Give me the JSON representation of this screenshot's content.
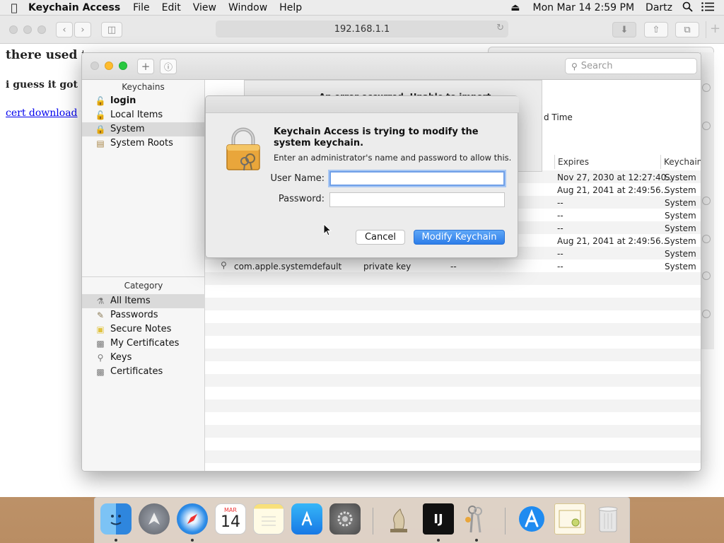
{
  "menubar": {
    "app_name": "Keychain Access",
    "menus": [
      "File",
      "Edit",
      "View",
      "Window",
      "Help"
    ],
    "clock": "Mon Mar 14  2:59 PM",
    "user": "Dartz"
  },
  "safari": {
    "url": "192.168.1.1",
    "page": {
      "heading1": "there used to",
      "heading2": "i guess it got los",
      "link": "cert download"
    }
  },
  "keychain": {
    "search_placeholder": "Search",
    "keychains_header": "Keychains",
    "keychains": [
      {
        "label": "login",
        "icon": "unlocked-lock-icon"
      },
      {
        "label": "Local Items",
        "icon": "unlocked-lock-icon"
      },
      {
        "label": "System",
        "icon": "locked-lock-icon"
      },
      {
        "label": "System Roots",
        "icon": "locked-lock-icon"
      }
    ],
    "category_header": "Category",
    "categories": [
      {
        "label": "All Items",
        "icon": "all-items-icon"
      },
      {
        "label": "Passwords",
        "icon": "password-icon"
      },
      {
        "label": "Secure Notes",
        "icon": "note-icon"
      },
      {
        "label": "My Certificates",
        "icon": "certificate-icon"
      },
      {
        "label": "Keys",
        "icon": "key-icon"
      },
      {
        "label": "Certificates",
        "icon": "certificate-icon"
      }
    ],
    "behind_text": "An error occurred. Unable to import",
    "behind_col": "d Time",
    "columns": {
      "expires": "Expires",
      "keychain": "Keychain"
    },
    "rows": [
      {
        "expires": "Nov 27, 2030 at 12:27:40...",
        "keychain": "System"
      },
      {
        "expires": "Aug 21, 2041 at 2:49:56...",
        "keychain": "System"
      },
      {
        "expires": "--",
        "keychain": "System"
      },
      {
        "expires": "--",
        "keychain": "System"
      },
      {
        "expires": "--",
        "keychain": "System"
      },
      {
        "expires": "Aug 21, 2041 at 2:49:56...",
        "keychain": "System"
      },
      {
        "expires": "--",
        "keychain": "System"
      },
      {
        "name": "com.apple.systemdefault",
        "kind": "private key",
        "date": "--",
        "expires": "--",
        "keychain": "System"
      }
    ]
  },
  "dialog": {
    "title": "Keychain Access is trying to modify the system keychain.",
    "subtitle": "Enter an administrator's name and password to allow this.",
    "username_label": "User Name:",
    "password_label": "Password:",
    "username_value": "",
    "password_value": "",
    "cancel": "Cancel",
    "confirm": "Modify Keychain"
  },
  "dock": {
    "calendar_month": "MAR",
    "calendar_day": "14",
    "intellij_label": "IJ"
  }
}
